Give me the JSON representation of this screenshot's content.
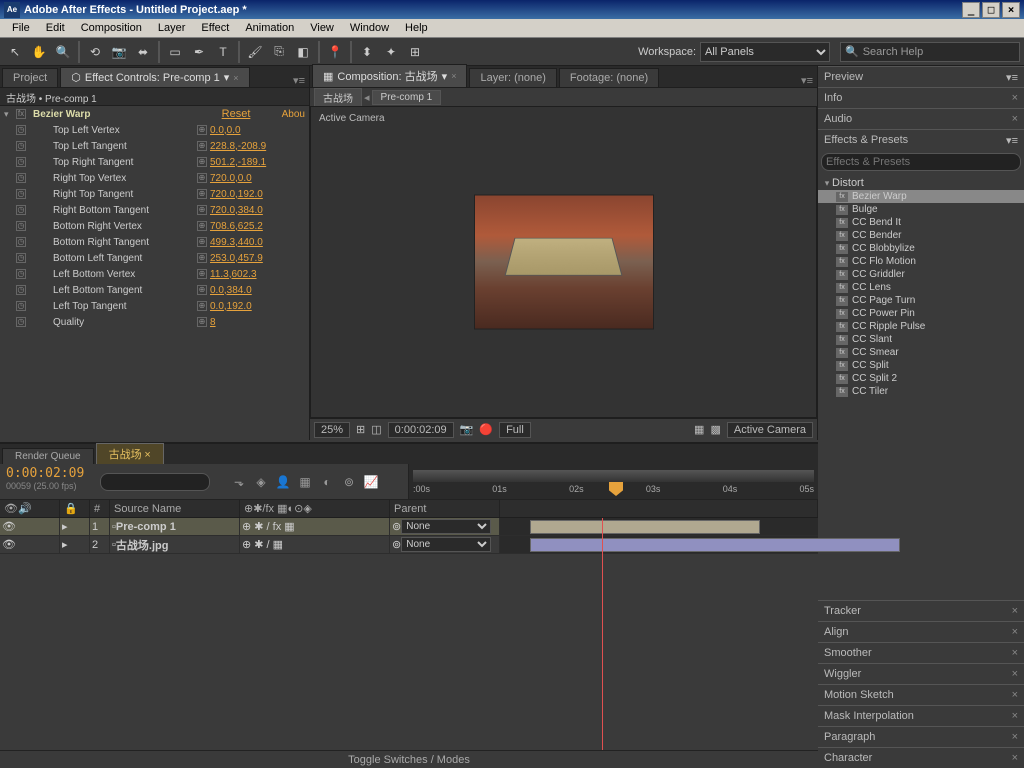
{
  "title": "Adobe After Effects - Untitled Project.aep *",
  "menu": [
    "File",
    "Edit",
    "Composition",
    "Layer",
    "Effect",
    "Animation",
    "View",
    "Window",
    "Help"
  ],
  "workspace": {
    "label": "Workspace:",
    "value": "All Panels"
  },
  "search_placeholder": "Search Help",
  "project_tab": "Project",
  "ec_tab": "Effect Controls: Pre-comp 1",
  "ec_header": "古战场 • Pre-comp 1",
  "effect": {
    "name": "Bezier Warp",
    "reset": "Reset",
    "about": "Abou",
    "params": [
      {
        "name": "Top Left Vertex",
        "value": "0.0,0.0"
      },
      {
        "name": "Top Left Tangent",
        "value": "228.8,-208.9"
      },
      {
        "name": "Top Right Tangent",
        "value": "501.2,-189.1"
      },
      {
        "name": "Right Top Vertex",
        "value": "720.0,0.0"
      },
      {
        "name": "Right Top Tangent",
        "value": "720.0,192.0"
      },
      {
        "name": "Right Bottom Tangent",
        "value": "720.0,384.0"
      },
      {
        "name": "Bottom Right Vertex",
        "value": "708.6,625.2"
      },
      {
        "name": "Bottom Right Tangent",
        "value": "499.3,440.0"
      },
      {
        "name": "Bottom Left Tangent",
        "value": "253.0,457.9"
      },
      {
        "name": "Left Bottom Vertex",
        "value": "11.3,602.3"
      },
      {
        "name": "Left Bottom Tangent",
        "value": "0.0,384.0"
      },
      {
        "name": "Left Top Tangent",
        "value": "0.0,192.0"
      },
      {
        "name": "Quality",
        "value": "8"
      }
    ]
  },
  "comp_tab": "Composition: 古战场",
  "layer_tab": "Layer: (none)",
  "footage_tab": "Footage: (none)",
  "breadcrumb": [
    "古战场",
    "Pre-comp 1"
  ],
  "viewer_label": "Active Camera",
  "viewer_footer": {
    "zoom": "25%",
    "time": "0:00:02:09",
    "res": "Full",
    "view": "Active Camera"
  },
  "timeline": {
    "tabs": [
      "Render Queue",
      "古战场"
    ],
    "timecode": "0:00:02:09",
    "sub": "00059 (25.00 fps)",
    "ruler": [
      ":00s",
      "01s",
      "02s",
      "03s",
      "04s",
      "05s"
    ],
    "cols": {
      "num": "#",
      "source": "Source Name",
      "parent": "Parent"
    },
    "layers": [
      {
        "num": "1",
        "name": "Pre-comp 1",
        "parent": "None",
        "sel": true
      },
      {
        "num": "2",
        "name": "古战场.jpg",
        "parent": "None",
        "sel": false
      }
    ],
    "footer": "Toggle Switches / Modes"
  },
  "right": {
    "panels": [
      "Preview",
      "Info",
      "Audio"
    ],
    "ep_title": "Effects & Presets",
    "category": "Distort",
    "items": [
      "Bezier Warp",
      "Bulge",
      "CC Bend It",
      "CC Bender",
      "CC Blobbylize",
      "CC Flo Motion",
      "CC Griddler",
      "CC Lens",
      "CC Page Turn",
      "CC Power Pin",
      "CC Ripple Pulse",
      "CC Slant",
      "CC Smear",
      "CC Split",
      "CC Split 2",
      "CC Tiler"
    ],
    "selected": "Bezier Warp",
    "bottom": [
      "Tracker",
      "Align",
      "Smoother",
      "Wiggler",
      "Motion Sketch",
      "Mask Interpolation",
      "Paragraph",
      "Character"
    ]
  }
}
